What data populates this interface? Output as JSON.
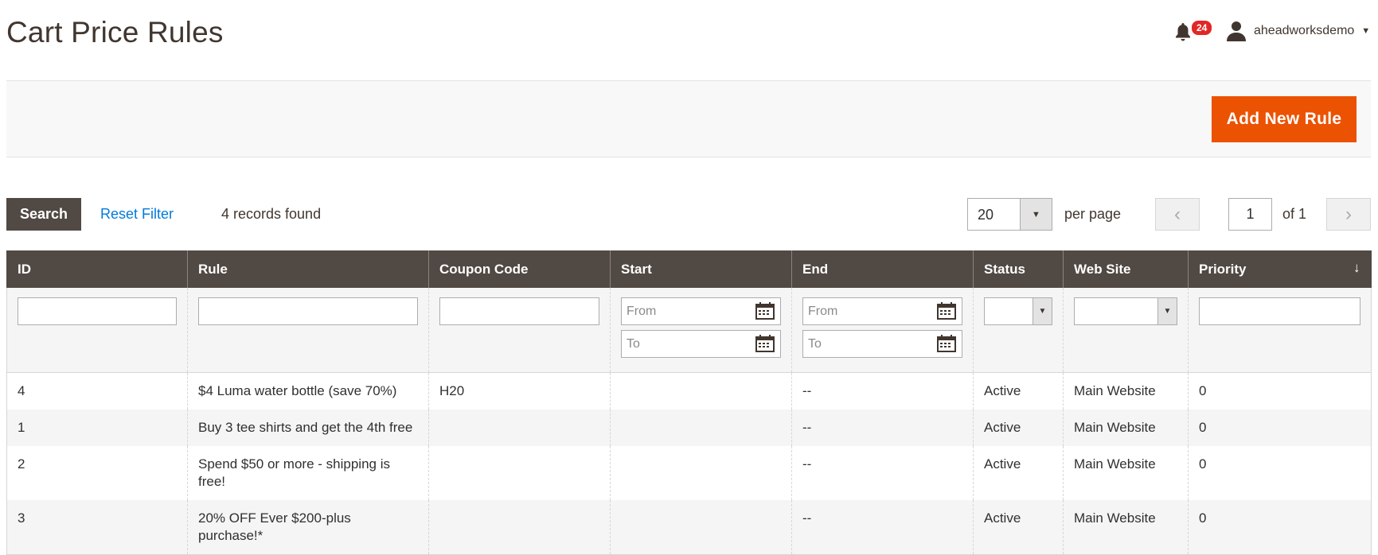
{
  "page": {
    "title": "Cart Price Rules"
  },
  "header": {
    "notifications_count": "24",
    "username": "aheadworksdemo"
  },
  "actions": {
    "add_rule_label": "Add New Rule"
  },
  "toolbar": {
    "search_label": "Search",
    "reset_label": "Reset Filter",
    "records_text": "4 records found",
    "per_page_value": "20",
    "per_page_label": "per page",
    "current_page": "1",
    "page_of": "of 1"
  },
  "columns": [
    "ID",
    "Rule",
    "Coupon Code",
    "Start",
    "End",
    "Status",
    "Web Site",
    "Priority"
  ],
  "filters": {
    "from_placeholder": "From",
    "to_placeholder": "To"
  },
  "rows": [
    {
      "id": "4",
      "rule": "$4 Luma water bottle (save 70%)",
      "coupon": "H20",
      "start": "",
      "end": "--",
      "status": "Active",
      "website": "Main Website",
      "priority": "0"
    },
    {
      "id": "1",
      "rule": "Buy 3 tee shirts and get the 4th free",
      "coupon": "",
      "start": "",
      "end": "--",
      "status": "Active",
      "website": "Main Website",
      "priority": "0"
    },
    {
      "id": "2",
      "rule": "Spend $50 or more - shipping is free!",
      "coupon": "",
      "start": "",
      "end": "--",
      "status": "Active",
      "website": "Main Website",
      "priority": "0"
    },
    {
      "id": "3",
      "rule": "20% OFF Ever $200-plus purchase!*",
      "coupon": "",
      "start": "",
      "end": "--",
      "status": "Active",
      "website": "Main Website",
      "priority": "0"
    }
  ],
  "colors": {
    "accent": "#eb5202",
    "header_bg": "#514943",
    "link": "#007bdb"
  }
}
